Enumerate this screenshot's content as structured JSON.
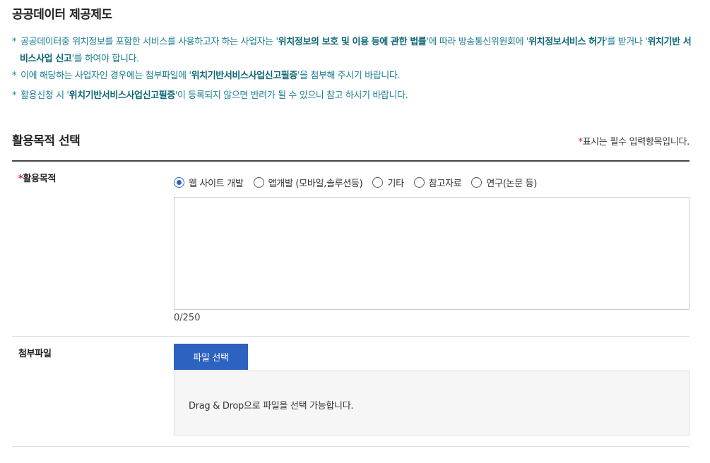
{
  "header": {
    "title": "공공데이터 제공제도"
  },
  "notices": {
    "star": "*",
    "n1_a": "공공데이터중 위치정보를 포함한 서비스를 사용하고자 하는 사업자는 '",
    "n1_b": "위치정보의 보호 및 이용 등에 관한 법률",
    "n1_c": "'에 따라 방송통신위원회에 '",
    "n1_d": "위치정보서비스 허가",
    "n1_e": "'를 받거나 '",
    "n1_f": "위치기반 서비스사업 신고",
    "n1_g": "'를 하여야 합니다.",
    "n2_a": "이에 해당하는 사업자인 경우에는 첨부파일에 '",
    "n2_b": "위치기반서비스사업신고필증",
    "n2_c": "'을 첨부해 주시기 바랍니다.",
    "n3_a": "활용신청 시 '",
    "n3_b": "위치기반서비스사업신고필증",
    "n3_c": "'이 등록되지 않으면 반려가 될 수 있으니 참고 하시기 바랍니다."
  },
  "section": {
    "title": "활용목적 선택",
    "required_mark": "*",
    "required_note": "표시는 필수 입력항목입니다."
  },
  "purpose": {
    "required_mark": "*",
    "label": "활용목적",
    "options": [
      {
        "label": "웹 사이트 개발",
        "checked": true
      },
      {
        "label": "앱개발 (모바일,솔루션등)",
        "checked": false
      },
      {
        "label": "기타",
        "checked": false
      },
      {
        "label": "참고자료",
        "checked": false
      },
      {
        "label": "연구(논문 등)",
        "checked": false
      }
    ],
    "text_value": "",
    "counter": "0/250"
  },
  "attachment": {
    "label": "첨부파일",
    "button_label": "파일 선택",
    "drop_text": "Drag & Drop으로 파일을 선택 가능합니다."
  },
  "colors": {
    "accent": "#2c62c0",
    "notice_text": "#1d7f93",
    "required": "#d9272e"
  }
}
